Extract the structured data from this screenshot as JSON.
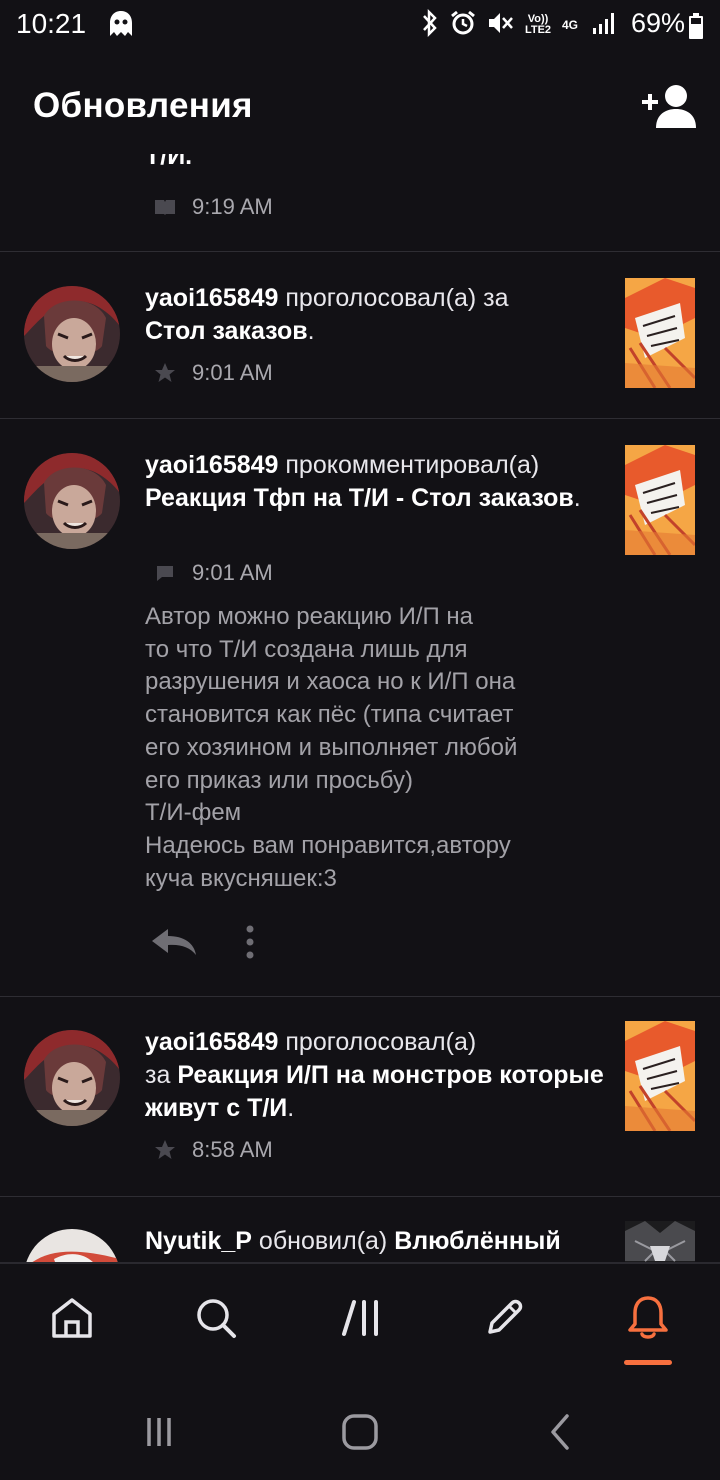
{
  "status_bar": {
    "time": "10:21",
    "battery": "69%",
    "icons": [
      "ghost-icon",
      "bluetooth-icon",
      "alarm-icon",
      "mute-icon",
      "volte-icon",
      "4g-icon",
      "signal-icon",
      "battery-icon"
    ],
    "volte_label": "Vo)) LTE2",
    "network_label": "4G"
  },
  "header": {
    "title": "Обновления",
    "add_friend_icon": "add-user-icon"
  },
  "feed": {
    "partial_top": {
      "tail_text": "Т/И.",
      "time": "9:19 AM",
      "icon": "book-icon"
    },
    "items": [
      {
        "user": "yaoi165849",
        "action": " проголосовал(а) за",
        "story": "Стол заказов",
        "end": ".",
        "time": "9:01 AM",
        "icon": "star-icon"
      },
      {
        "user": "yaoi165849",
        "action": " прокомментировал(а)",
        "story": "Реакция Тфп на Т/И - Стол заказов",
        "end": ".",
        "time": "9:01 AM",
        "icon": "comment-icon",
        "comment": "Автор можно реакцию И/П на\nто что Т/И создана лишь для\nразрушения и хаоса но к И/П она\nстановится как пёс (типа считает\nего хозяином и выполняет любой\nего приказ или просьбу)\nТ/И-фем\nНадеюсь вам понравится,автору\nкуча вкусняшек:3"
      },
      {
        "user": "yaoi165849",
        "action": " проголосовал(а)\nза ",
        "story": "Реакция И/П на монстров которые живут с Т/И",
        "end": ".",
        "time": "8:58 AM",
        "icon": "star-icon"
      },
      {
        "user": "Nyutik_P",
        "action": " обновил(а) ",
        "story": "Влюблённый"
      }
    ]
  },
  "bottom_nav": {
    "items": [
      "home-icon",
      "search-icon",
      "library-icon",
      "write-icon",
      "notifications-icon"
    ],
    "active": "notifications-icon",
    "accent": "#f7703f"
  },
  "system_nav": [
    "recents-button",
    "home-button",
    "back-button"
  ]
}
